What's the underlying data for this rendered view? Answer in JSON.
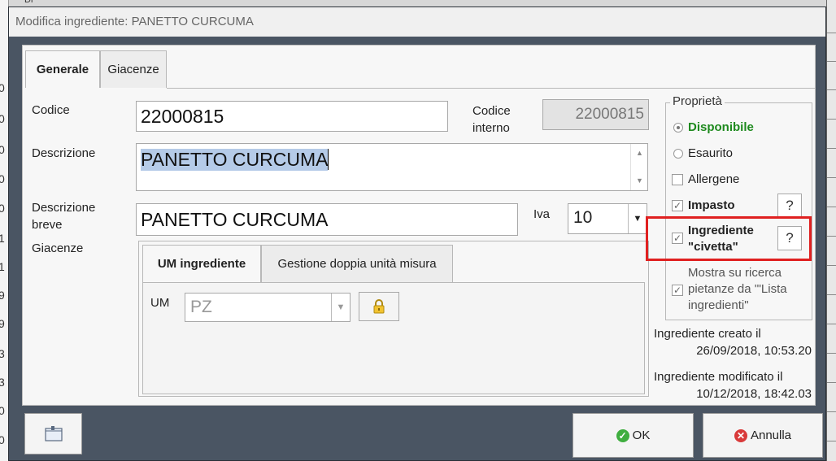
{
  "window": {
    "title": "Modifica ingrediente: PANETTO CURCUMA"
  },
  "tabs": [
    {
      "label": "Generale",
      "active": true
    },
    {
      "label": "Giacenze",
      "active": false
    }
  ],
  "form": {
    "codice_label": "Codice",
    "codice_value": "22000815",
    "codice_interno_label_1": "Codice",
    "codice_interno_label_2": "interno",
    "codice_interno_value": "22000815",
    "descrizione_label": "Descrizione",
    "descrizione_value": "PANETTO CURCUMA",
    "descrizione_breve_label_1": "Descrizione",
    "descrizione_breve_label_2": "breve",
    "descrizione_breve_value": "PANETTO CURCUMA",
    "iva_label": "Iva",
    "iva_value": "10",
    "giacenze_label": "Giacenze"
  },
  "giacenze_tabs": [
    {
      "label": "UM ingrediente",
      "active": true
    },
    {
      "label": "Gestione doppia unità misura",
      "active": false
    }
  ],
  "um": {
    "label": "UM",
    "value": "PZ"
  },
  "proprieta": {
    "title": "Proprietà",
    "disponibile": {
      "label": "Disponibile",
      "selected": true,
      "color": "#1e8a1e"
    },
    "esaurito": {
      "label": "Esaurito",
      "selected": false
    },
    "allergene": {
      "label": "Allergene",
      "checked": false
    },
    "impasto": {
      "label": "Impasto",
      "checked": true,
      "help": "?"
    },
    "civetta": {
      "label_1": "Ingrediente",
      "label_2": "\"civetta\"",
      "checked": true,
      "help": "?",
      "highlight_color": "#e02020"
    },
    "mostra": {
      "label_1": "Mostra su ricerca",
      "label_2": "pietanze da '\"Lista",
      "label_3": "ingredienti\"",
      "checked": true
    }
  },
  "info": {
    "creato_label": "Ingrediente creato il",
    "creato_value": "26/09/2018, 10:53.20",
    "modificato_label": "Ingrediente modificato il",
    "modificato_value": "10/12/2018, 18:42.03"
  },
  "buttons": {
    "ok": "OK",
    "annulla": "Annulla"
  },
  "background": {
    "left_digits": [
      "0",
      "0",
      "0",
      "0",
      "0",
      "1",
      "1",
      "9",
      "9",
      "3",
      "3",
      "0",
      "0"
    ],
    "top_fragment": "Di"
  }
}
